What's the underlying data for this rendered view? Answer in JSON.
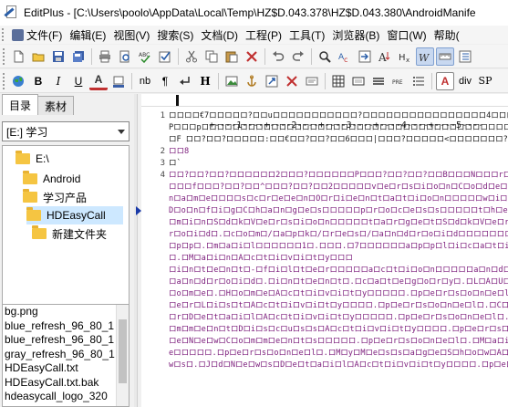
{
  "window": {
    "title": "EditPlus - [C:\\Users\\poolo\\AppData\\Local\\Temp\\HZ$D.043.378\\HZ$D.043.380\\AndroidManife"
  },
  "menu": [
    {
      "label": "文件(F)",
      "color": "#5a6e9a"
    },
    {
      "label": "编辑(E)",
      "color": ""
    },
    {
      "label": "视图(V)",
      "color": ""
    },
    {
      "label": "搜索(S)",
      "color": ""
    },
    {
      "label": "文档(D)",
      "color": ""
    },
    {
      "label": "工程(P)",
      "color": ""
    },
    {
      "label": "工具(T)",
      "color": ""
    },
    {
      "label": "浏览器(B)",
      "color": ""
    },
    {
      "label": "窗口(W)",
      "color": ""
    },
    {
      "label": "帮助(",
      "color": ""
    }
  ],
  "toolbar2_text": {
    "bold": "B",
    "italic": "I",
    "underline": "U",
    "font_color": "A",
    "nb": "nb",
    "para_break": "¶",
    "heading": "H",
    "font_btn": "A",
    "div": "div",
    "sp": "SP"
  },
  "left_panel": {
    "tabs": [
      "目录",
      "素材"
    ],
    "drive": "[E:] 学习",
    "tree": [
      "E:\\",
      "Android",
      "学习产品",
      "HDEasyCall",
      "新建文件夹"
    ],
    "files": [
      "bg.png",
      "blue_refresh_96_80_1",
      "blue_refresh_96_80_1",
      "gray_refresh_96_80_1",
      "HDEasyCall.txt",
      "HDEasyCall.txt.bak",
      "hdeasycall_logo_320"
    ]
  },
  "editor": {
    "ruler": "+----1----+----2----+----3----+----4----+----5----",
    "line_numbers": [
      "1",
      "",
      "",
      "2",
      "3",
      "4",
      "",
      "",
      "",
      "",
      "",
      "",
      "",
      "",
      "",
      "",
      "",
      "",
      "",
      "",
      "",
      "",
      "",
      "",
      "",
      ""
    ],
    "lines": [
      {
        "text": "ロロロロ€7ロロロロロ?ロロuロロロロロロロロロロロ?ロロロロロロロロロロロロロロロロ4ロロロBロロロPロロロ",
        "color": "#1a1a1a"
      },
      {
        "text": "Pロロロpロロロロロロロロロロロロロロロロロロロロロロロロロロロロロロロロロロロロロロロロロロロロロロロロロロロロロロロロロロロロロロロロロロロロロロロロロロロロロロロロロロロロロロロロロロロロロロロロロロロロロロ",
        "color": "#1a1a1a"
      },
      {
        "text": "ロF ロロ?ロロ?ロロロロロ:ロロ€ロロ?ロロ?ロロ6ロロロ|ロロロ?ロロロロロ<ロロロロロロロ?ロロロロロ",
        "color": "#1a1a1a"
      },
      {
        "text": "ロロ8",
        "color": "#7a1a7a"
      },
      {
        "text": "ロ`",
        "color": "#1a1a1a"
      },
      {
        "text": "ロロ?ロロ?ロロ?ロロロロロロ2ロロロ?ロロロロロロPロロロ?ロロ?ロロ?ロロBロロロNロロロrロロロ?ロロロ",
        "color": "#7a1a7a"
      },
      {
        "text": "ロロロfロロロ?ロロ?ロロ^ロロロ?ロロ?ロロ2ロロロロロvロeロrロsロiロoロnロCロoロdロeロロロ",
        "color": "#7a1a7a"
      },
      {
        "text": "nロaロmロeロロロロsロcロrロeロeロnロOロrロiロeロnロtロaロtロiロoロnロロロロロwロiロ",
        "color": "#7a1a7a"
      },
      {
        "text": "DロoロnロfロiロgロCロhロaロnロgロeロsロロロロロpロrロoロcロeロsロsロロロロロtロhロeロ",
        "color": "#7a1a7a"
      },
      {
        "text": "ロmロiロnロSロdロkロVロeロrロsロiロoロnロロロロロtロaロrロgロeロtロSロdロkロVロeロrロ",
        "color": "#7a1a7a"
      },
      {
        "text": "rロoロiロdロ.ロcロoロmロ/ロaロpロkロ/ロrロeロsロ/ロaロnロdロrロoロiロdロロロロロロロロ",
        "color": "#7a1a7a"
      },
      {
        "text": "ロpロpロ.ロmロaロiロlロロロロロロ1ロ.ロロロ.ロ7ロロロロロロaロpロpロlロiロcロaロtロiロoロnロ",
        "color": "#7a1a7a"
      },
      {
        "text": "ロ.ロMロaロiロnロAロcロtロiロvロiロtロyロロロ",
        "color": "#7a1a7a"
      },
      {
        "text": "ロiロnロtロeロnロtロ-ロfロiロlロtロeロrロロロロロaロcロtロiロoロnロロロロロaロnロdロrロ",
        "color": "#7a1a7a"
      },
      {
        "text": "ロaロnロdロrロoロiロdロ.ロiロnロtロeロnロtロ.ロcロaロtロeロgロoロrロyロ.ロLロAロUロ",
        "color": "#7a1a7a"
      },
      {
        "text": "ロoロmロeロ.ロHロoロmロeロAロcロtロiロvロiロtロyロロロロロ.ロpロeロrロsロoロnロeロlロ",
        "color": "#7a1a7a"
      },
      {
        "text": "ロeロrロLロiロsロtロAロcロtロiロvロiロtロyロロロロ.ロpロeロrロsロoロnロeロlロ.ロCロ",
        "color": "#7a1a7a"
      },
      {
        "text": "ロrロDロeロtロaロiロlロAロcロtロiロvロiロtロyロロロロロ.ロpロeロrロsロoロnロeロlロ.ロ",
        "color": "#7a1a7a"
      },
      {
        "text": "ロmロmロeロnロtロDロiロsロcロuロsロsロAロcロtロiロvロiロtロyロロロロ.ロpロeロrロsロoロ",
        "color": "#7a1a7a"
      },
      {
        "text": "ロeロNロeロwロCロoロmロmロeロnロtロsロロロロロ.ロpロeロrロsロoロnロeロlロ.ロMロaロiロ",
        "color": "#7a1a7a"
      },
      {
        "text": "eロロロロロ.ロpロeロrロsロoロnロeロlロ.ロMロyロMロeロsロsロaロgロeロSロhロoロwロAロ",
        "color": "#7a1a7a"
      },
      {
        "text": "wロsロ.ロJロdロNロeロwロsロDロeロtロaロiロlロAロcロtロiロvロiロtロyロロロロ.ロpロeロ",
        "color": "#7a1a7a"
      }
    ]
  }
}
